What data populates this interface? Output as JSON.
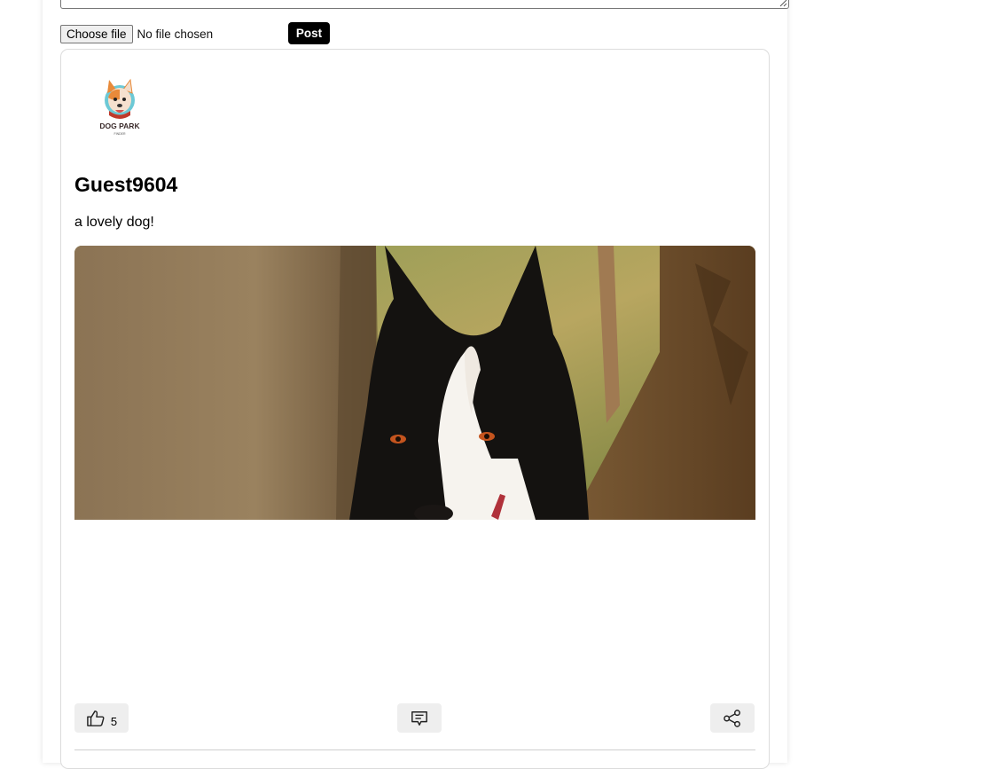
{
  "composer": {
    "choose_file_label": "Choose file",
    "file_status": "No file chosen",
    "post_label": "Post"
  },
  "post": {
    "logo_text": "DOG PARK",
    "logo_subtext": "FINDER",
    "username": "Guest9604",
    "caption": "a lovely dog!",
    "likes": "5"
  },
  "icons": {
    "like": "thumbs-up-icon",
    "comment": "comment-icon",
    "share": "share-icon"
  },
  "colors": {
    "post_button": "#000000",
    "action_button": "#eeeeee",
    "logo_accent": "#e88a3a",
    "logo_circle": "#6cc9d6"
  }
}
